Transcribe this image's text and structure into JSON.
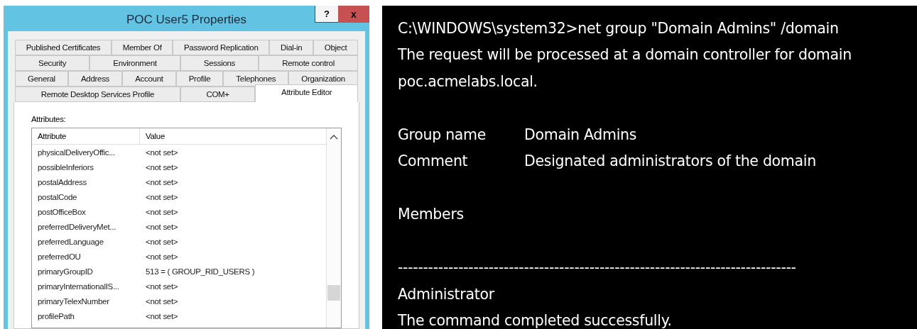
{
  "dialog": {
    "title": "POC User5 Properties",
    "help_button": "?",
    "close_button": "x",
    "tab_rows": [
      [
        {
          "label": "Published Certificates",
          "selected": false
        },
        {
          "label": "Member Of",
          "selected": false
        },
        {
          "label": "Password Replication",
          "selected": false
        },
        {
          "label": "Dial-in",
          "selected": false
        },
        {
          "label": "Object",
          "selected": false
        }
      ],
      [
        {
          "label": "Security",
          "selected": false
        },
        {
          "label": "Environment",
          "selected": false
        },
        {
          "label": "Sessions",
          "selected": false
        },
        {
          "label": "Remote control",
          "selected": false
        }
      ],
      [
        {
          "label": "General",
          "selected": false
        },
        {
          "label": "Address",
          "selected": false
        },
        {
          "label": "Account",
          "selected": false
        },
        {
          "label": "Profile",
          "selected": false
        },
        {
          "label": "Telephones",
          "selected": false
        },
        {
          "label": "Organization",
          "selected": false
        }
      ],
      [
        {
          "label": "Remote Desktop Services Profile",
          "selected": false
        },
        {
          "label": "COM+",
          "selected": false
        },
        {
          "label": "Attribute Editor",
          "selected": true
        }
      ]
    ],
    "attributes_label": "Attributes:",
    "table": {
      "columns": [
        "Attribute",
        "Value"
      ],
      "rows": [
        [
          "physicalDeliveryOffic...",
          "<not set>"
        ],
        [
          "possibleInferiors",
          "<not set>"
        ],
        [
          "postalAddress",
          "<not set>"
        ],
        [
          "postalCode",
          "<not set>"
        ],
        [
          "postOfficeBox",
          "<not set>"
        ],
        [
          "preferredDeliveryMet...",
          "<not set>"
        ],
        [
          "preferredLanguage",
          "<not set>"
        ],
        [
          "preferredOU",
          "<not set>"
        ],
        [
          "primaryGroupID",
          "513 = ( GROUP_RID_USERS )"
        ],
        [
          "primaryInternationalIS...",
          "<not set>"
        ],
        [
          "primaryTelexNumber",
          "<not set>"
        ],
        [
          "profilePath",
          "<not set>"
        ]
      ]
    }
  },
  "terminal": {
    "lines": [
      {
        "kind": "text",
        "text": "C:\\WINDOWS\\system32>net group \"Domain Admins\" /domain"
      },
      {
        "kind": "text",
        "text": "The request will be processed at a domain controller for domain"
      },
      {
        "kind": "text",
        "text": "poc.acmelabs.local."
      },
      {
        "kind": "blank"
      },
      {
        "kind": "field",
        "label": "Group name",
        "value": "Domain Admins"
      },
      {
        "kind": "field",
        "label": "Comment",
        "value": "Designated administrators of the domain"
      },
      {
        "kind": "blank"
      },
      {
        "kind": "text",
        "text": "Members"
      },
      {
        "kind": "blank"
      },
      {
        "kind": "text",
        "text": "-------------------------------------------------------------------------------"
      },
      {
        "kind": "text",
        "text": "Administrator"
      },
      {
        "kind": "text",
        "text": "The command completed successfully."
      }
    ]
  }
}
